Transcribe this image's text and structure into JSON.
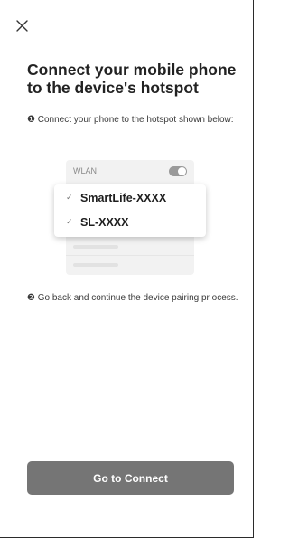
{
  "header": {
    "close_icon": "close-icon"
  },
  "title": "Connect your mobile phone to the device's hotspot",
  "steps": [
    {
      "marker": "❶",
      "text": "Connect your phone to the hotspot shown below:"
    },
    {
      "marker": "❷",
      "text": "Go back and continue the device pairing pr ocess."
    }
  ],
  "illustration": {
    "wlan_label": "WLAN",
    "toggle_on": true,
    "networks": [
      {
        "check": "✓",
        "name": "SmartLife-XXXX"
      },
      {
        "check": "✓",
        "name": "SL-XXXX"
      }
    ]
  },
  "action": {
    "label": "Go to Connect"
  },
  "colors": {
    "button": "#757575",
    "button_text": "#ffffff",
    "card_bg": "#f2f2f2"
  }
}
